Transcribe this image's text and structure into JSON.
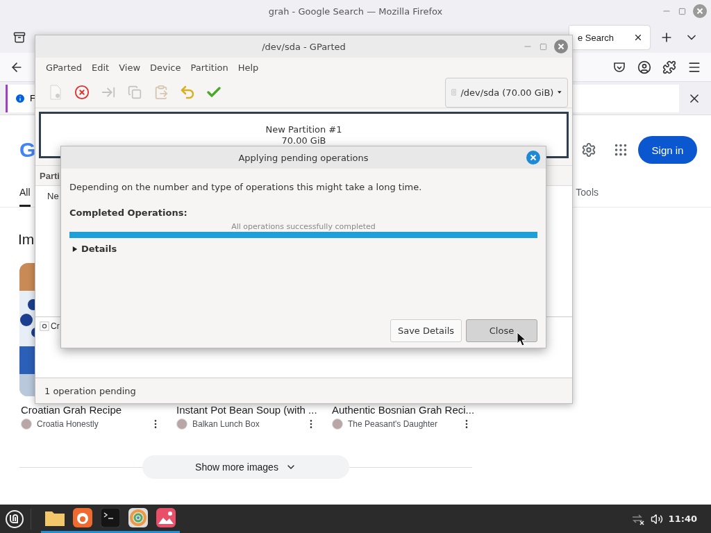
{
  "firefox": {
    "title": "grah - Google Search — Mozilla Firefox",
    "tab": {
      "label": "e Search"
    },
    "notification": {
      "text": "F"
    },
    "google": {
      "logo": "G",
      "sign_in": "Sign in",
      "tabs": [
        {
          "label": "All",
          "selected": true
        },
        {
          "label": "Tools",
          "selected": false
        }
      ],
      "heading": "Im",
      "results": [
        {
          "title": "Croatian Grah Recipe",
          "source": "Croatia Honestly"
        },
        {
          "title": "Instant Pot Bean Soup (with ...",
          "source": "Balkan Lunch Box"
        },
        {
          "title": "Authentic Bosnian Grah Reci...",
          "source": "The Peasant's Daughter"
        }
      ],
      "show_more": "Show more images"
    }
  },
  "gparted": {
    "title": "/dev/sda - GParted",
    "menu": [
      "GParted",
      "Edit",
      "View",
      "Device",
      "Partition",
      "Help"
    ],
    "toolbar": [
      {
        "kind": "new",
        "disabled": true
      },
      {
        "kind": "delete",
        "disabled": false
      },
      {
        "kind": "resize",
        "disabled": true
      },
      {
        "kind": "copy",
        "disabled": true
      },
      {
        "kind": "paste",
        "disabled": true
      },
      {
        "kind": "undo",
        "disabled": false
      },
      {
        "kind": "apply",
        "disabled": false
      }
    ],
    "device": "/dev/sda (70.00 GiB)",
    "partition": {
      "name": "New Partition #1",
      "size": "70.00 GiB"
    },
    "list_header": "Parti",
    "list_row": "Ne",
    "pending_item": "Cr",
    "status": "1 operation pending"
  },
  "dialog": {
    "title": "Applying pending operations",
    "message": "Depending on the number and type of operations this might take a long time.",
    "completed_label": "Completed Operations:",
    "progress": {
      "level": 1,
      "text": "All operations successfully completed"
    },
    "details": {
      "label": "Details",
      "expanded": false
    },
    "buttons": [
      {
        "label": "Save Details",
        "hovered": false
      },
      {
        "label": "Close",
        "hovered": true
      }
    ]
  },
  "taskbar": {
    "apps": [
      {
        "kind": "files",
        "running": true
      },
      {
        "kind": "firefox",
        "running": true
      },
      {
        "kind": "terminal",
        "running": true
      },
      {
        "kind": "disks",
        "running": true
      },
      {
        "kind": "photos",
        "running": true
      }
    ],
    "clock": "11:40"
  }
}
